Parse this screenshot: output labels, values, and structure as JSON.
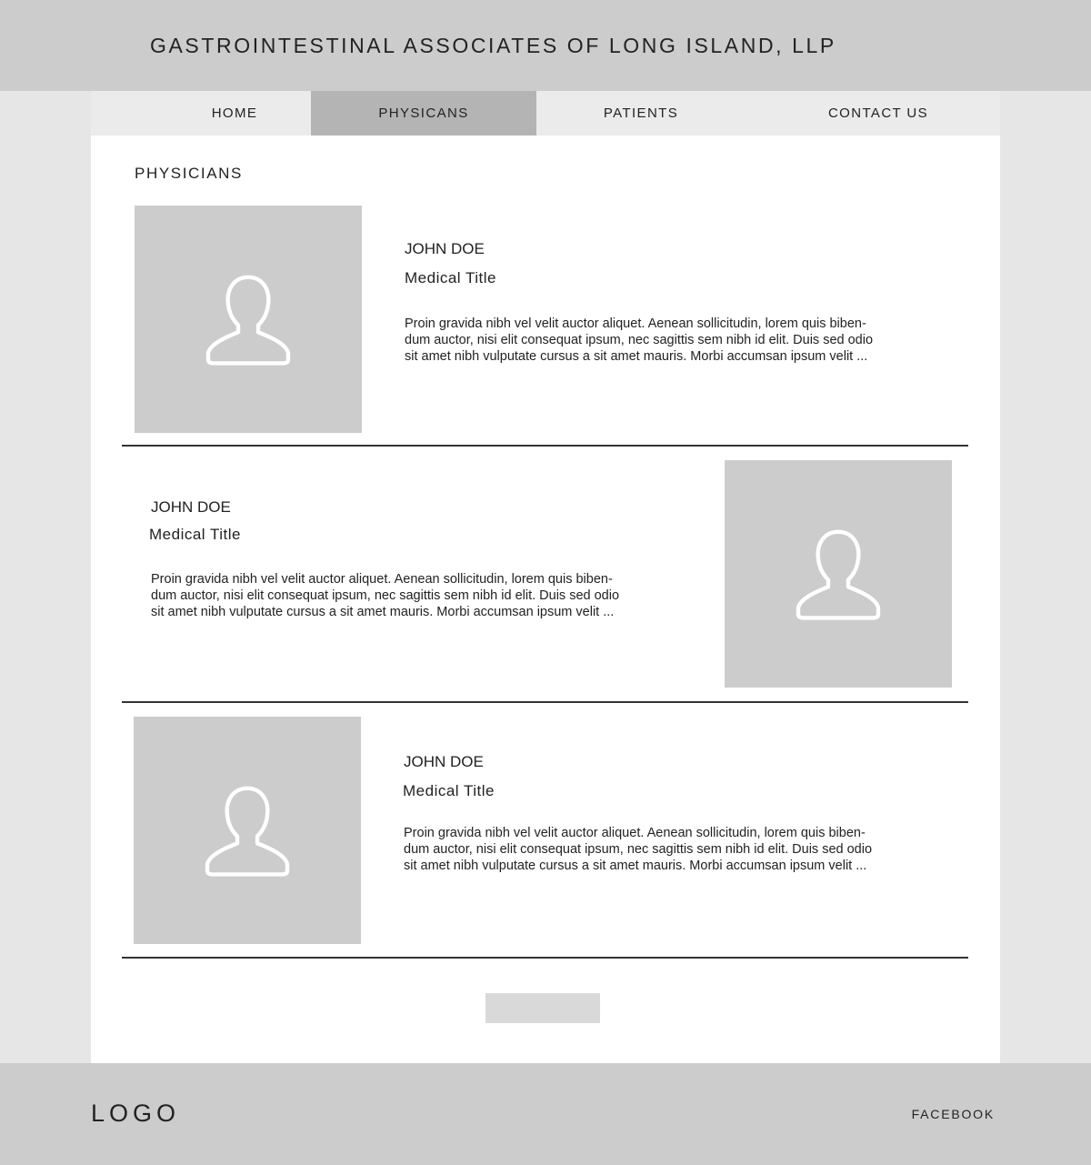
{
  "header": {
    "site_title": "GASTROINTESTINAL ASSOCIATES OF LONG ISLAND, LLP"
  },
  "nav": {
    "items": [
      {
        "label": "HOME",
        "active": false
      },
      {
        "label": "PHYSICANS",
        "active": true
      },
      {
        "label": "PATIENTS",
        "active": false
      },
      {
        "label": "CONTACT US",
        "active": false
      }
    ]
  },
  "main": {
    "section_title": "PHYSICIANS",
    "physicians": [
      {
        "name": "JOHN DOE",
        "title": "Medical  Title",
        "bio": [
          "Proin gravida nibh vel velit auctor aliquet. Aenean sollicitudin, lorem quis biben-",
          "dum auctor, nisi elit consequat ipsum, nec sagittis sem nibh id elit. Duis sed odio",
          "sit amet nibh vulputate cursus a sit amet mauris. Morbi accumsan ipsum velit ..."
        ],
        "photo_icon": "user-placeholder-icon"
      },
      {
        "name": "JOHN DOE",
        "title": "Medical  Title",
        "bio": [
          "Proin gravida nibh vel velit auctor aliquet. Aenean sollicitudin, lorem quis biben-",
          "dum auctor, nisi elit consequat ipsum, nec sagittis sem nibh id elit. Duis sed odio",
          "sit amet nibh vulputate cursus a sit amet mauris. Morbi accumsan ipsum velit ..."
        ],
        "photo_icon": "user-placeholder-icon"
      },
      {
        "name": "JOHN DOE",
        "title": "Medical  Title",
        "bio": [
          "Proin gravida nibh vel velit auctor aliquet. Aenean sollicitudin, lorem quis biben-",
          "dum auctor, nisi elit consequat ipsum, nec sagittis sem nibh id elit. Duis sed odio",
          "sit amet nibh vulputate cursus a sit amet mauris. Morbi accumsan ipsum velit ..."
        ],
        "photo_icon": "user-placeholder-icon"
      }
    ]
  },
  "footer": {
    "logo": "LOGO",
    "facebook": "FACEBOOK"
  },
  "colors": {
    "header_bg": "#cccccc",
    "page_bg": "#e6e6e6",
    "nav_bg": "#ebebeb",
    "nav_active_bg": "#b4b4b4",
    "placeholder_bg": "#cccccc"
  }
}
